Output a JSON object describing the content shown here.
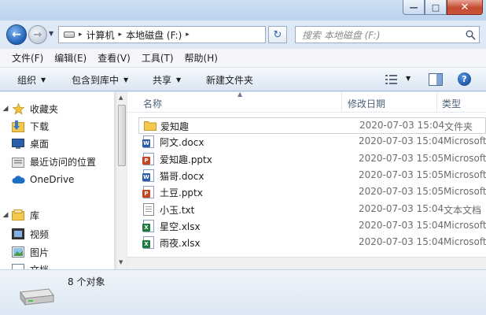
{
  "window": {
    "minimize_glyph": "—",
    "maximize_glyph": "□",
    "close_glyph": "✕"
  },
  "address": {
    "crumbs": [
      "计算机",
      "本地磁盘 (F:)"
    ],
    "search_placeholder": "搜索 本地磁盘 (F:)"
  },
  "menu": [
    "文件(F)",
    "编辑(E)",
    "查看(V)",
    "工具(T)",
    "帮助(H)"
  ],
  "commands": {
    "organize": "组织",
    "include_library": "包含到库中",
    "share": "共享",
    "new_folder": "新建文件夹",
    "help": "?"
  },
  "nav": {
    "favorites": "收藏夹",
    "downloads": "下载",
    "desktop": "桌面",
    "recent": "最近访问的位置",
    "onedrive": "OneDrive",
    "libraries": "库",
    "videos": "视频",
    "pictures": "图片",
    "documents": "文档"
  },
  "columns": {
    "name": "名称",
    "date": "修改日期",
    "type": "类型"
  },
  "files": [
    {
      "name": "爱知趣",
      "date": "2020-07-03 15:04",
      "type": "文件夹",
      "icon": "folder-icon",
      "selected": true
    },
    {
      "name": "阿文.docx",
      "date": "2020-07-03 15:04",
      "type": "Microsoft",
      "icon": "word-icon"
    },
    {
      "name": "爱知趣.pptx",
      "date": "2020-07-03 15:05",
      "type": "Microsoft",
      "icon": "powerpoint-icon"
    },
    {
      "name": "猫哥.docx",
      "date": "2020-07-03 15:05",
      "type": "Microsoft",
      "icon": "word-icon"
    },
    {
      "name": "土豆.pptx",
      "date": "2020-07-03 15:05",
      "type": "Microsoft",
      "icon": "powerpoint-icon"
    },
    {
      "name": "小玉.txt",
      "date": "2020-07-03 15:04",
      "type": "文本文档",
      "icon": "text-file-icon"
    },
    {
      "name": "星空.xlsx",
      "date": "2020-07-03 15:04",
      "type": "Microsoft",
      "icon": "excel-icon"
    },
    {
      "name": "雨夜.xlsx",
      "date": "2020-07-03 15:04",
      "type": "Microsoft",
      "icon": "excel-icon"
    }
  ],
  "status": {
    "count": "8 个对象"
  },
  "colors": {
    "word": "#2b5aa8",
    "powerpoint": "#c8461f",
    "excel": "#1e7a3e",
    "folder": "#f2c94c"
  }
}
